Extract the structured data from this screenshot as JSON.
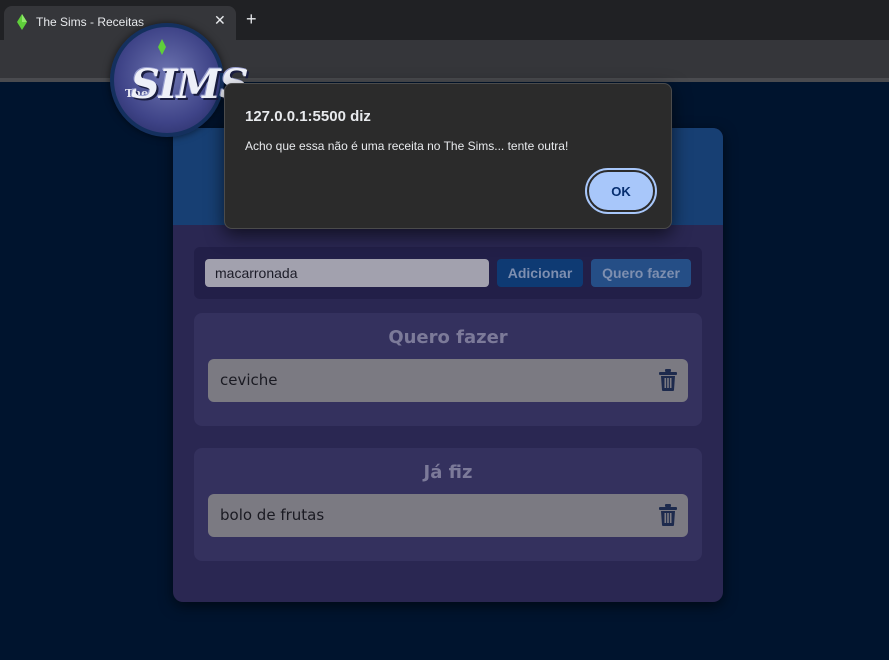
{
  "browser": {
    "tab_title": "The Sims - Receitas",
    "tab_close": "✕",
    "new_tab": "+"
  },
  "logo": {
    "the": "The",
    "word": "SIMS"
  },
  "form": {
    "input_value": "macarronada",
    "add_label": "Adicionar",
    "want_label": "Quero fazer"
  },
  "lists": {
    "want": {
      "title": "Quero fazer",
      "items": [
        "ceviche"
      ]
    },
    "done": {
      "title": "Já fiz",
      "items": [
        "bolo de frutas"
      ]
    }
  },
  "dialog": {
    "title": "127.0.0.1:5500 diz",
    "message": "Acho que essa não é uma receita no The Sims... tente outra!",
    "ok_label": "OK"
  },
  "icons": {
    "favicon": "plumbob-icon",
    "delete": "trash-icon"
  },
  "colors": {
    "page_bg": "#00142e",
    "card_bg": "#2a2752",
    "header_bg": "#173f73",
    "dialog_button": "#a8c7fa"
  }
}
